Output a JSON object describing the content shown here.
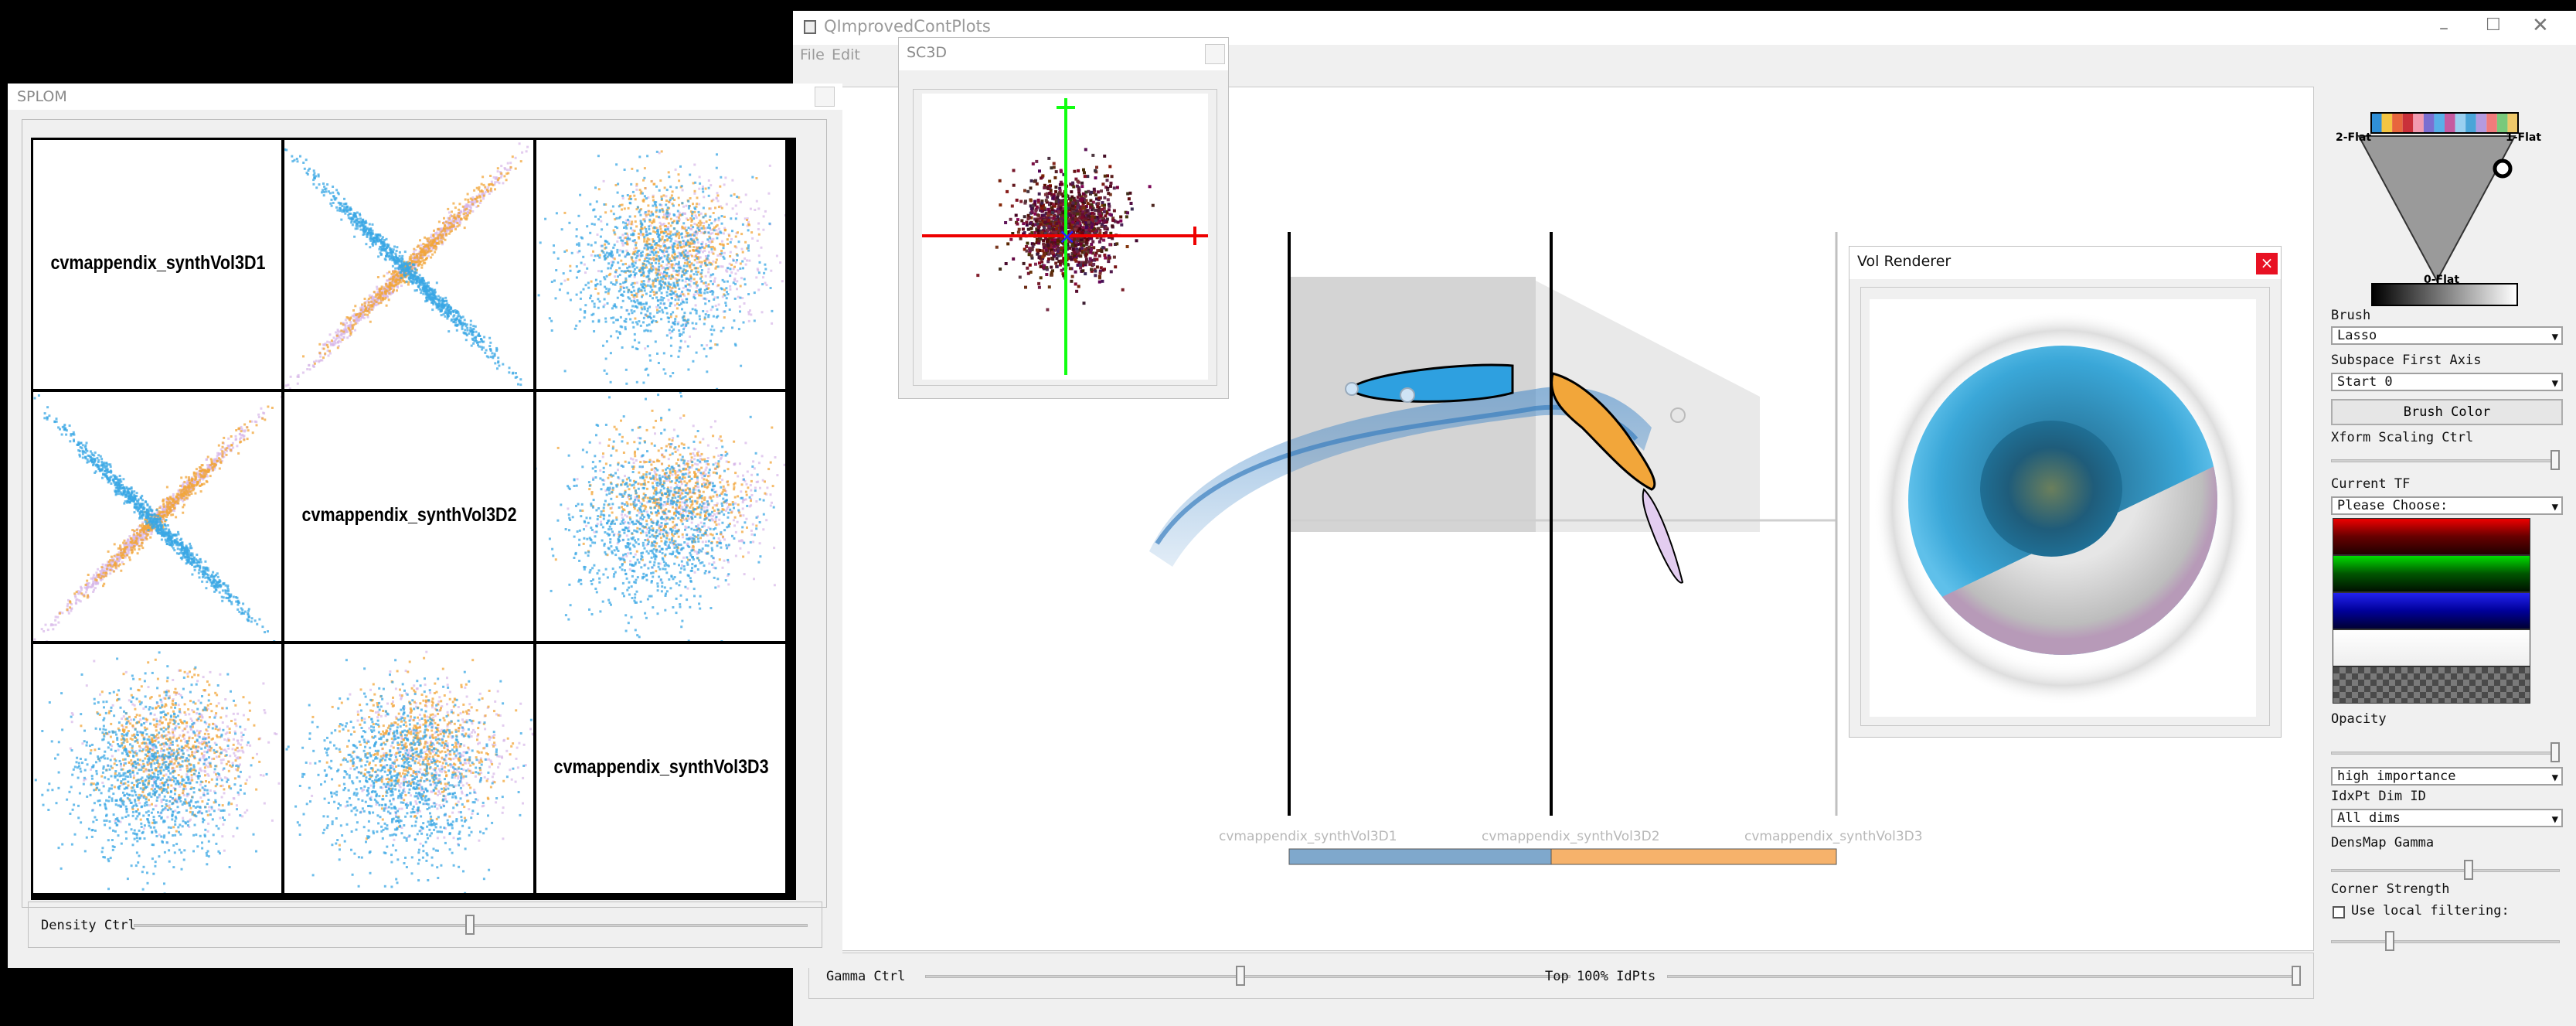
{
  "main_window": {
    "title": "QImprovedContPlots",
    "menu": [
      "File",
      "Edit"
    ],
    "controls": [
      "minimize",
      "maximize",
      "close"
    ]
  },
  "pcp": {
    "axes": [
      {
        "label": "cvmappendix_synthVol3D1"
      },
      {
        "label": "cvmappendix_synthVol3D2"
      },
      {
        "label": "cvmappendix_synthVol3D3"
      }
    ],
    "colors": {
      "blue": "#3aa7e4",
      "orange": "#f2a63a",
      "lavender": "#d7b7e8",
      "bar_blue": "#7fa8cc",
      "bar_orange": "#f6b26b"
    }
  },
  "bottom_bar": {
    "gamma_label": "Gamma Ctrl",
    "gamma_value": 0.28,
    "top_label": "Top 100% IdPts",
    "top_value": 1.0
  },
  "right_panel": {
    "brush_label": "Brush",
    "brush_value": "Lasso",
    "subspace_label": "Subspace First Axis",
    "subspace_value": "Start 0",
    "brush_color_button": "Brush Color",
    "xform_label": "Xform Scaling Ctrl",
    "xform_value": 0.98,
    "current_tf_label": "Current TF",
    "current_tf_value": "Please Choose:",
    "opacity_label": "Opacity",
    "opacity_value": 0.98,
    "importance_value": "high importance",
    "idxpt_label": "IdxPt Dim ID",
    "idxpt_value": "All dims",
    "densmap_label": "DensMap Gamma",
    "densmap_value": 0.6,
    "corner_label": "Corner Strength",
    "local_filter_label": "Use local filtering:",
    "corner_value": 0.25,
    "triangle_labels": {
      "left": "2-Flat",
      "right": "1-Flat",
      "bottom": "0-Flat"
    },
    "palette": [
      "#2f8fd6",
      "#f4c542",
      "#e8663d",
      "#c9303a",
      "#f29bb0",
      "#7b6fd1",
      "#58b0e8",
      "#c65ba0",
      "#9ad0f0",
      "#4aa5d8",
      "#b49adf",
      "#f07b7b",
      "#79c97b",
      "#eec86a"
    ]
  },
  "splom_window": {
    "title": "SPLOM",
    "labels": [
      "cvmappendix_synthVol3D1",
      "cvmappendix_synthVol3D2",
      "cvmappendix_synthVol3D3"
    ],
    "density_label": "Density Ctrl",
    "density_value": 0.5
  },
  "sc3d_window": {
    "title": "SC3D"
  },
  "vol_window": {
    "title": "Vol Renderer",
    "close_glyph": "×"
  }
}
